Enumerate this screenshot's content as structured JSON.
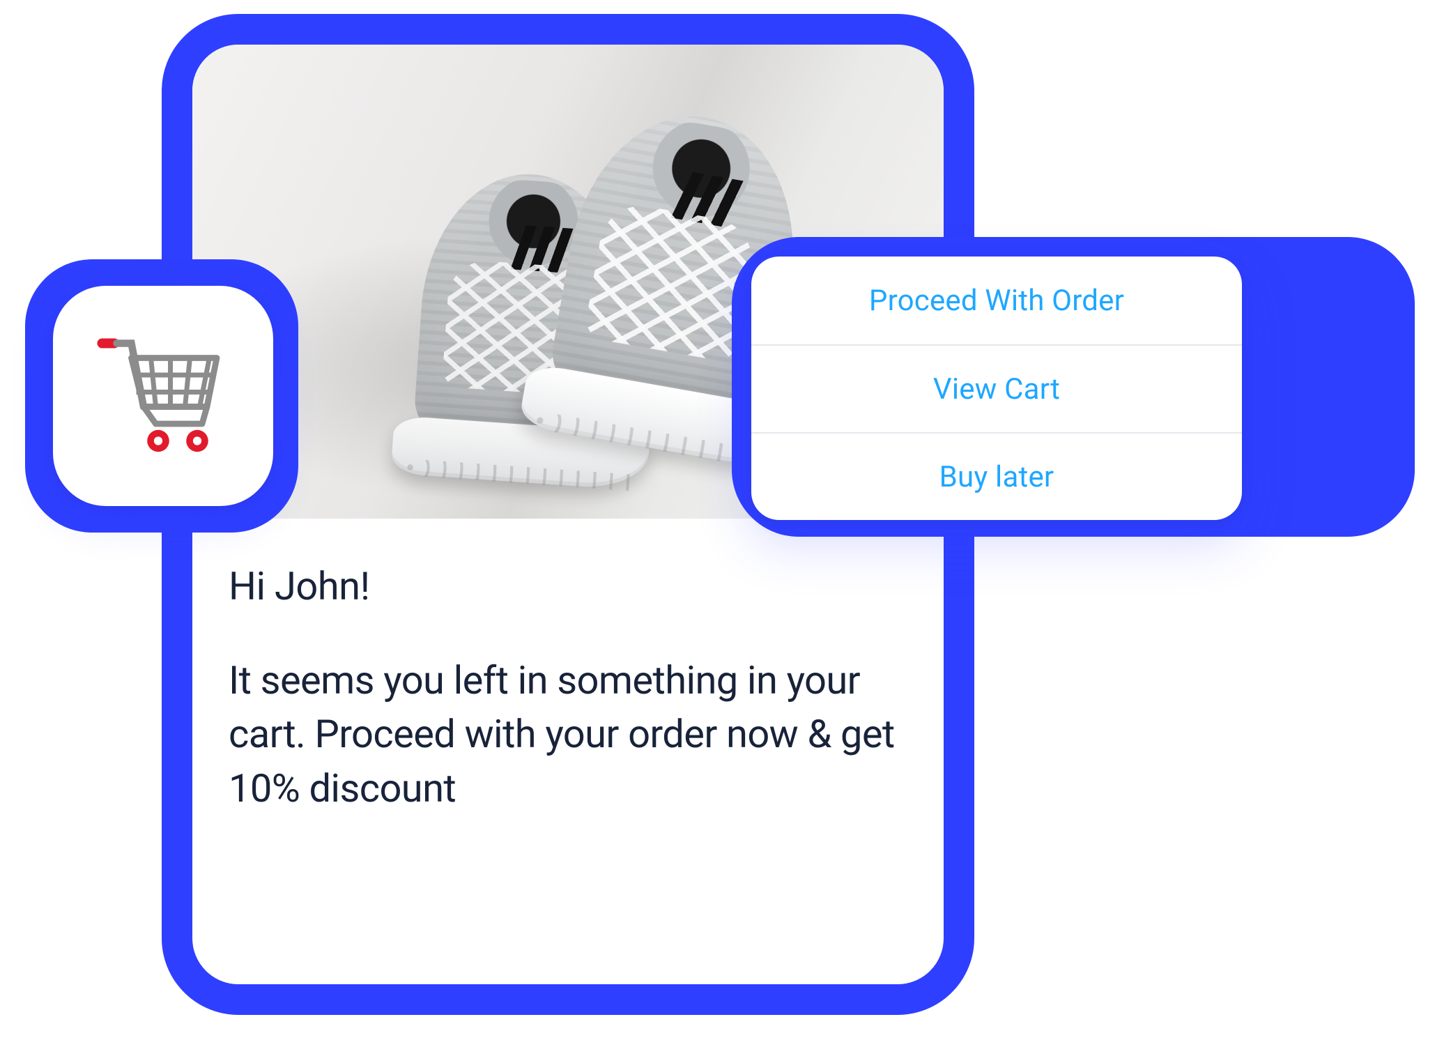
{
  "colors": {
    "brand": "#2F3FFF",
    "actionLink": "#1EA7FF",
    "text": "#18233A"
  },
  "product": {
    "image_desc": "Pair of grey athletic sneakers with white midsole, three black stripes on the tongue, resting against a light grey surface"
  },
  "cartIcon": {
    "name": "shopping-cart-icon"
  },
  "message": {
    "greeting": "Hi John!",
    "body": "It seems you left in something in your cart. Proceed with your order now & get 10% discount"
  },
  "actions": [
    {
      "label": "Proceed With Order"
    },
    {
      "label": "View Cart"
    },
    {
      "label": "Buy later"
    }
  ]
}
